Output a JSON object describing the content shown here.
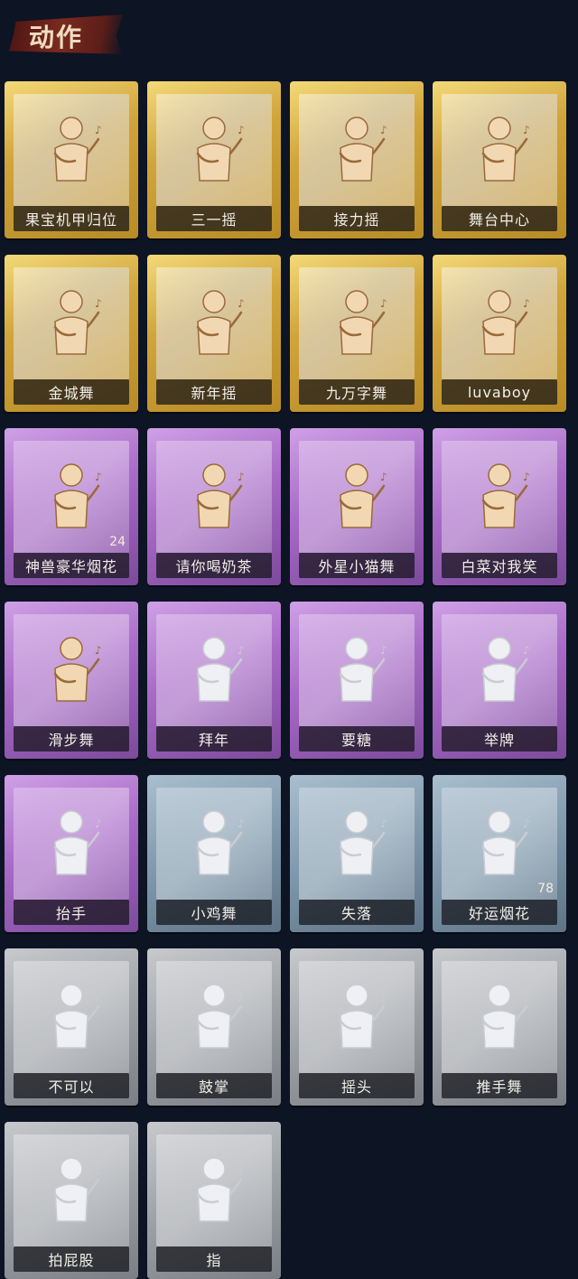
{
  "header": {
    "title": "动作"
  },
  "actions": [
    {
      "label": "果宝机甲归位",
      "rarity": "gold",
      "icon": "dancer-icon"
    },
    {
      "label": "三一摇",
      "rarity": "gold",
      "icon": "dancer-icon"
    },
    {
      "label": "接力摇",
      "rarity": "gold",
      "icon": "dancer-icon"
    },
    {
      "label": "舞台中心",
      "rarity": "gold",
      "icon": "dancer-icon"
    },
    {
      "label": "金城舞",
      "rarity": "gold",
      "icon": "dancer-icon"
    },
    {
      "label": "新年摇",
      "rarity": "gold",
      "icon": "dancer-icon"
    },
    {
      "label": "九万字舞",
      "rarity": "gold",
      "icon": "dancer-icon"
    },
    {
      "label": "luvaboy",
      "rarity": "gold",
      "icon": "dancer-icon"
    },
    {
      "label": "神兽豪华烟花",
      "rarity": "purple",
      "icon": "fireworks-icon",
      "count": "24"
    },
    {
      "label": "请你喝奶茶",
      "rarity": "purple",
      "icon": "milk-tea-icon"
    },
    {
      "label": "外星小猫舞",
      "rarity": "purple",
      "icon": "dancer-icon"
    },
    {
      "label": "白菜对我笑",
      "rarity": "purple",
      "icon": "dancer-icon"
    },
    {
      "label": "滑步舞",
      "rarity": "purple",
      "icon": "dancer-icon"
    },
    {
      "label": "拜年",
      "rarity": "purple",
      "icon": "bow-icon"
    },
    {
      "label": "要糖",
      "rarity": "purple",
      "icon": "reach-icon"
    },
    {
      "label": "举牌",
      "rarity": "purple",
      "icon": "sign-icon"
    },
    {
      "label": "抬手",
      "rarity": "purple",
      "icon": "raise-hand-icon"
    },
    {
      "label": "小鸡舞",
      "rarity": "blue",
      "icon": "chicken-dance-icon"
    },
    {
      "label": "失落",
      "rarity": "blue",
      "icon": "crawl-icon"
    },
    {
      "label": "好运烟花",
      "rarity": "blue",
      "icon": "firework-can-icon",
      "count": "78"
    },
    {
      "label": "不可以",
      "rarity": "gray",
      "icon": "finger-wag-icon"
    },
    {
      "label": "鼓掌",
      "rarity": "gray",
      "icon": "clap-icon"
    },
    {
      "label": "摇头",
      "rarity": "gray",
      "icon": "shake-head-icon"
    },
    {
      "label": "推手舞",
      "rarity": "gray",
      "icon": "push-hands-icon"
    },
    {
      "label": "拍屁股",
      "rarity": "gray",
      "icon": "pat-icon"
    },
    {
      "label": "指",
      "rarity": "gray",
      "icon": "point-icon"
    }
  ],
  "colors": {
    "background": "#0d1424",
    "gold": "#d1a53a",
    "purple": "#a86ac7",
    "blue": "#7e97aa",
    "gray": "#9da1a6",
    "figure_gold": "#f2d8b2",
    "figure_muted": "#eef0f3"
  }
}
